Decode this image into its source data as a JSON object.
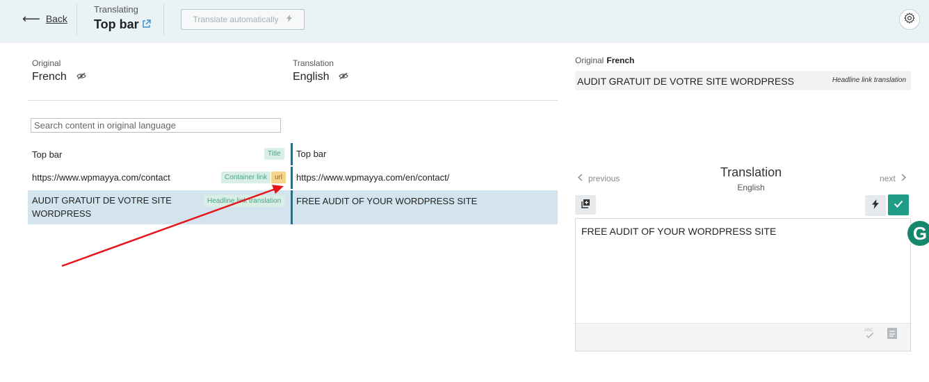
{
  "header": {
    "back_label": "Back",
    "translating_label": "Translating",
    "title": "Top bar",
    "auto_translate_label": "Translate automatically"
  },
  "languages": {
    "original_label": "Original",
    "original_lang": "French",
    "translation_label": "Translation",
    "translation_lang": "English"
  },
  "search": {
    "placeholder": "Search content in original language"
  },
  "rows": [
    {
      "original": "Top bar",
      "tags": [
        "Title"
      ],
      "translation": "Top bar"
    },
    {
      "original": "https://www.wpmayya.com/contact",
      "tags": [
        "Container link",
        "url"
      ],
      "translation": "https://www.wpmayya.com/en/contact/"
    },
    {
      "original": "AUDIT GRATUIT DE VOTRE SITE WORDPRESS",
      "tags": [
        "Headline link translation"
      ],
      "translation": "FREE AUDIT OF YOUR WORDPRESS SITE",
      "selected": true
    }
  ],
  "panel": {
    "original_label": "Original",
    "original_lang": "French",
    "original_text": "AUDIT GRATUIT DE VOTRE SITE WORDPRESS",
    "original_tag": "Headline link translation",
    "previous_label": "previous",
    "next_label": "next",
    "translation_title": "Translation",
    "translation_lang": "English",
    "editor_text": "FREE AUDIT OF YOUR WORDPRESS SITE"
  },
  "colors": {
    "accent": "#1f9d87",
    "divider": "#2d6e86",
    "selected_row": "#d3e4ee",
    "header_bg": "#e9f2f5",
    "annotation_arrow": "#e8141b"
  },
  "icons": [
    "back-arrow-icon",
    "external-link-icon",
    "lightning-icon",
    "gear-icon",
    "eye-slash-icon",
    "chevron-left-icon",
    "chevron-right-icon",
    "copy-icon",
    "check-icon",
    "spellcheck-icon",
    "glossary-icon",
    "grammarly-icon"
  ]
}
